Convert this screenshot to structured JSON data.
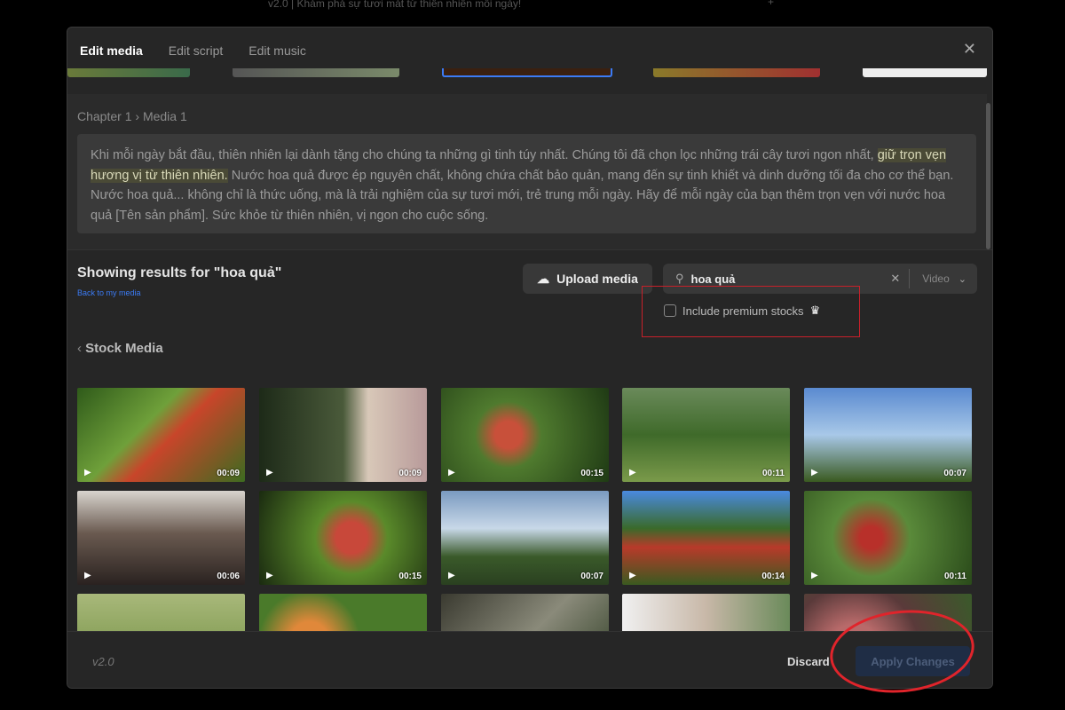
{
  "background": {
    "title_text": "v2.0 | Khám phá sự tươi mát từ thiên nhiên mỗi ngày!",
    "plus": "+"
  },
  "tabs": [
    {
      "label": "Edit media",
      "active": true
    },
    {
      "label": "Edit script"
    },
    {
      "label": "Edit music"
    }
  ],
  "close": "✕",
  "breadcrumb": {
    "chapter": "Chapter 1",
    "sep": "›",
    "media": "Media 1"
  },
  "script": {
    "before": "Khi mỗi ngày bắt đầu, thiên nhiên lại dành tặng cho chúng ta những gì tinh túy nhất. Chúng tôi đã chọn lọc những trái cây tươi ngon nhất, ",
    "highlight": "giữ trọn vẹn hương vị từ thiên nhiên.",
    "after": " Nước hoa quả được ép nguyên chất, không chứa chất bảo quản, mang đến sự tinh khiết và dinh dưỡng tối đa cho cơ thể bạn. Nước hoa quả... không chỉ là thức uống, mà là trải nghiệm của sự tươi mới, trẻ trung mỗi ngày. Hãy để mỗi ngày của bạn thêm trọn vẹn với nước hoa quả [Tên sản phẩm]. Sức khỏe từ thiên nhiên, vị ngon cho cuộc sống."
  },
  "results": {
    "heading": "Showing results for \"hoa quả\"",
    "back_link": "Back to my media"
  },
  "upload_label": "Upload media",
  "search": {
    "value": "hoa quả",
    "type": "Video"
  },
  "premium_label": "Include premium stocks",
  "premium_checked": false,
  "section_title": "Stock Media",
  "thumbnails": [
    {
      "duration": "00:09",
      "bg": "linear-gradient(135deg,#2f5a1a,#6fa03a 40%,#c8452a 55%,#3d6b20)"
    },
    {
      "duration": "00:09",
      "bg": "linear-gradient(90deg,#1d2a18,#4a5a3a 50%,#d8c8b8 65%,#b89a9a)"
    },
    {
      "duration": "00:15",
      "bg": "radial-gradient(circle at 40% 50%,#c8503a 12%,#4f7a2e 30%,#1f3a14)"
    },
    {
      "duration": "00:11",
      "bg": "linear-gradient(180deg,#6a8a5a,#3f6a2a 50%,#7a9a4a)"
    },
    {
      "duration": "00:07",
      "bg": "linear-gradient(180deg,#5a8ad0,#a8c8e8 50%,#3a5a20)"
    },
    {
      "duration": "00:06",
      "bg": "linear-gradient(180deg,#d8d4ce,#6a5a50 45%,#2a2220)"
    },
    {
      "duration": "00:15",
      "bg": "radial-gradient(circle at 55% 50%,#c8483a 15%,#5a8a2a 35%,#1a2a10)"
    },
    {
      "duration": "00:07",
      "bg": "linear-gradient(180deg,#7a9ac0,#c8d8e8 40%,#3a5a2a 70%,#2a4020)"
    },
    {
      "duration": "00:14",
      "bg": "linear-gradient(180deg,#4a8ae0,#3a6a2a 40%,#b83a2a 60%,#3a5a20)"
    },
    {
      "duration": "00:11",
      "bg": "radial-gradient(circle at 40% 50%,#b8302a 10%,#5a8a3a 35%,#2a4a1a)"
    },
    {
      "duration": "",
      "bg": "linear-gradient(180deg,#a8b87a,#6a8a3a)"
    },
    {
      "duration": "",
      "bg": "radial-gradient(circle at 30% 50%,#e0883a 15%,#4a7a2a 40%)"
    },
    {
      "duration": "",
      "bg": "linear-gradient(135deg,#3a3a30,#8a8a7a 50%,#2a3a20)"
    },
    {
      "duration": "",
      "bg": "linear-gradient(90deg,#f0f0f0,#c8b8a8 50%,#6a8a5a)"
    },
    {
      "duration": "",
      "bg": "radial-gradient(circle at 30% 60%,#b86a6a 20%,#5a3a3a 50%,#3a5a2a)"
    }
  ],
  "footer": {
    "version": "v2.0",
    "discard": "Discard",
    "apply": "Apply Changes"
  },
  "colors": {
    "accent_link": "#3b7bf5",
    "annotation_red": "#e0242b"
  }
}
